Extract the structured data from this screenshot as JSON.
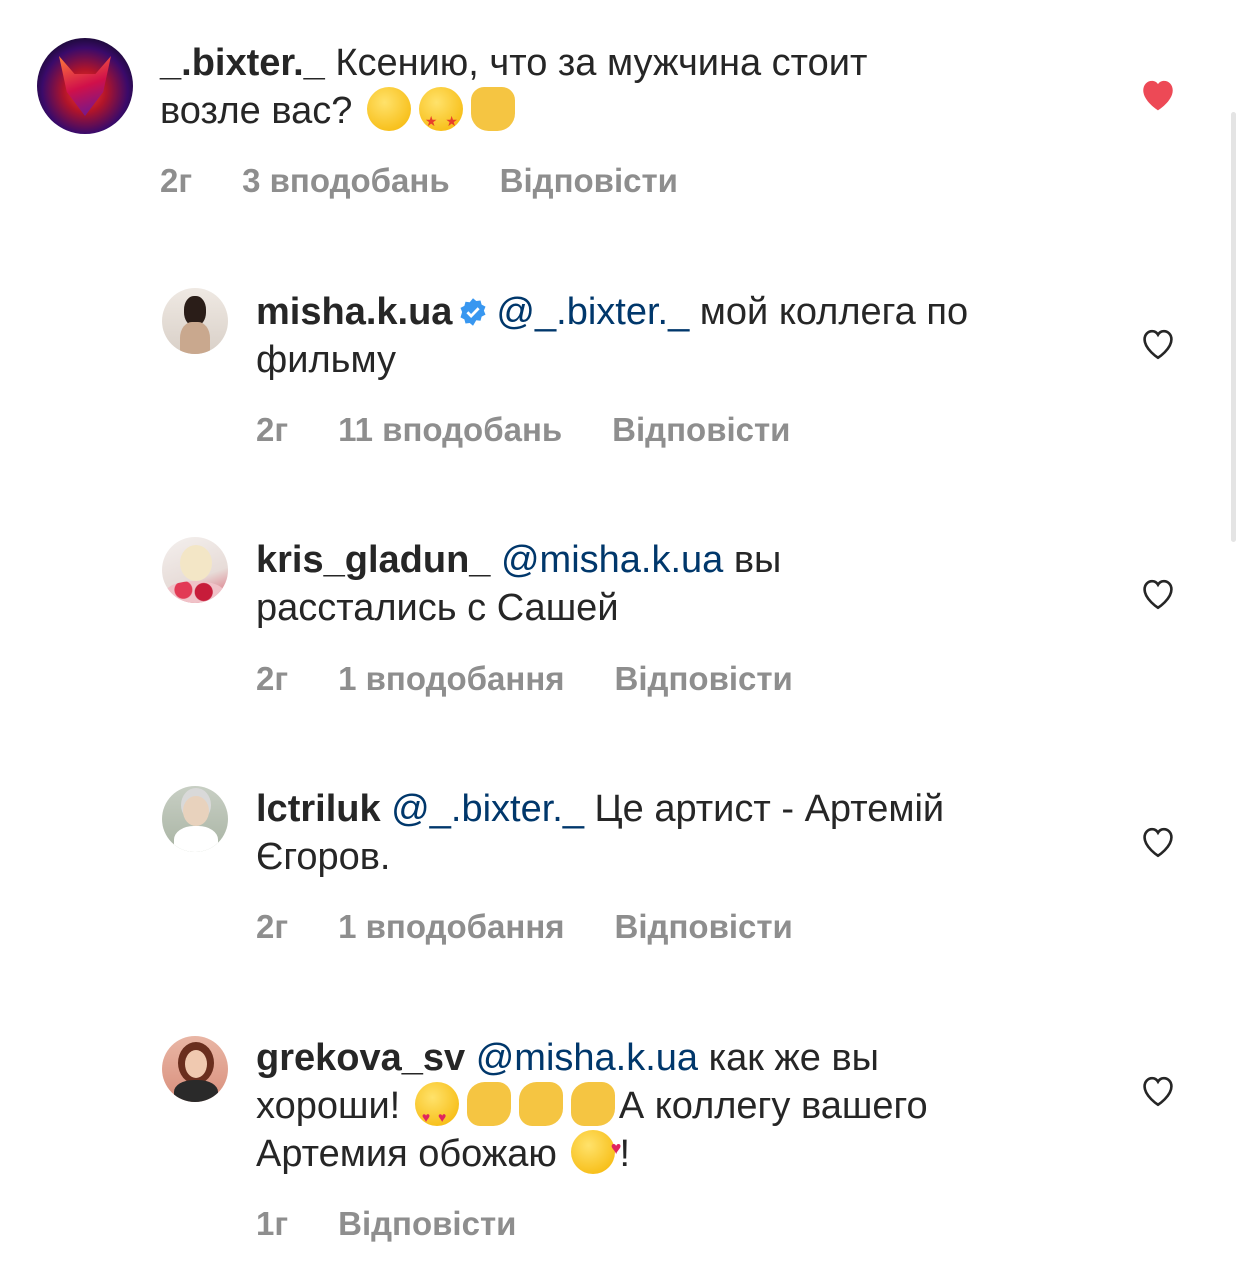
{
  "comments": [
    {
      "username": "_.bixter._",
      "mention": "",
      "text_line1": " Ксению, что за мужчина стоит",
      "text_line2": "возле вас? ",
      "time": "2г",
      "likes": "3 вподобань",
      "reply": "Відповісти",
      "liked": true,
      "emojis": [
        "thinking-face",
        "star-struck",
        "thumbs-up"
      ]
    },
    {
      "username": "misha.k.ua",
      "mention": "@_.bixter._",
      "text_line1": " мой коллега по",
      "text_line2": "фильму",
      "time": "2г",
      "likes": "11 вподобань",
      "reply": "Відповісти",
      "liked": false,
      "verified": true
    },
    {
      "username": "kris_gladun_",
      "mention": "@misha.k.ua",
      "text_line1": " вы",
      "text_line2": "расстались с Сашей",
      "time": "2г",
      "likes": "1 вподобання",
      "reply": "Відповісти",
      "liked": false
    },
    {
      "username": "lctriluk",
      "mention": "@_.bixter._",
      "text_line1": " Це артист - Артемій",
      "text_line2": "Єгоров.",
      "time": "2г",
      "likes": "1 вподобання",
      "reply": "Відповісти",
      "liked": false
    },
    {
      "username": "grekova_sv",
      "mention": "@misha.k.ua",
      "text_line1": " как же вы",
      "text_line2a": "хороши! ",
      "text_line2b": "А коллегу вашего",
      "text_line3a": "Артемия обожаю ",
      "text_line3b": "!",
      "time": "1г",
      "reply": "Відповісти",
      "liked": false,
      "emojis": [
        "heart-eyes",
        "clapping-hands",
        "clapping-hands",
        "clapping-hands",
        "smiling-face-with-hearts"
      ]
    }
  ],
  "colors": {
    "text": "#262626",
    "mention": "#00376b",
    "meta": "#8e8e8e",
    "liked_heart": "#ed4956",
    "verified": "#3897f0"
  }
}
